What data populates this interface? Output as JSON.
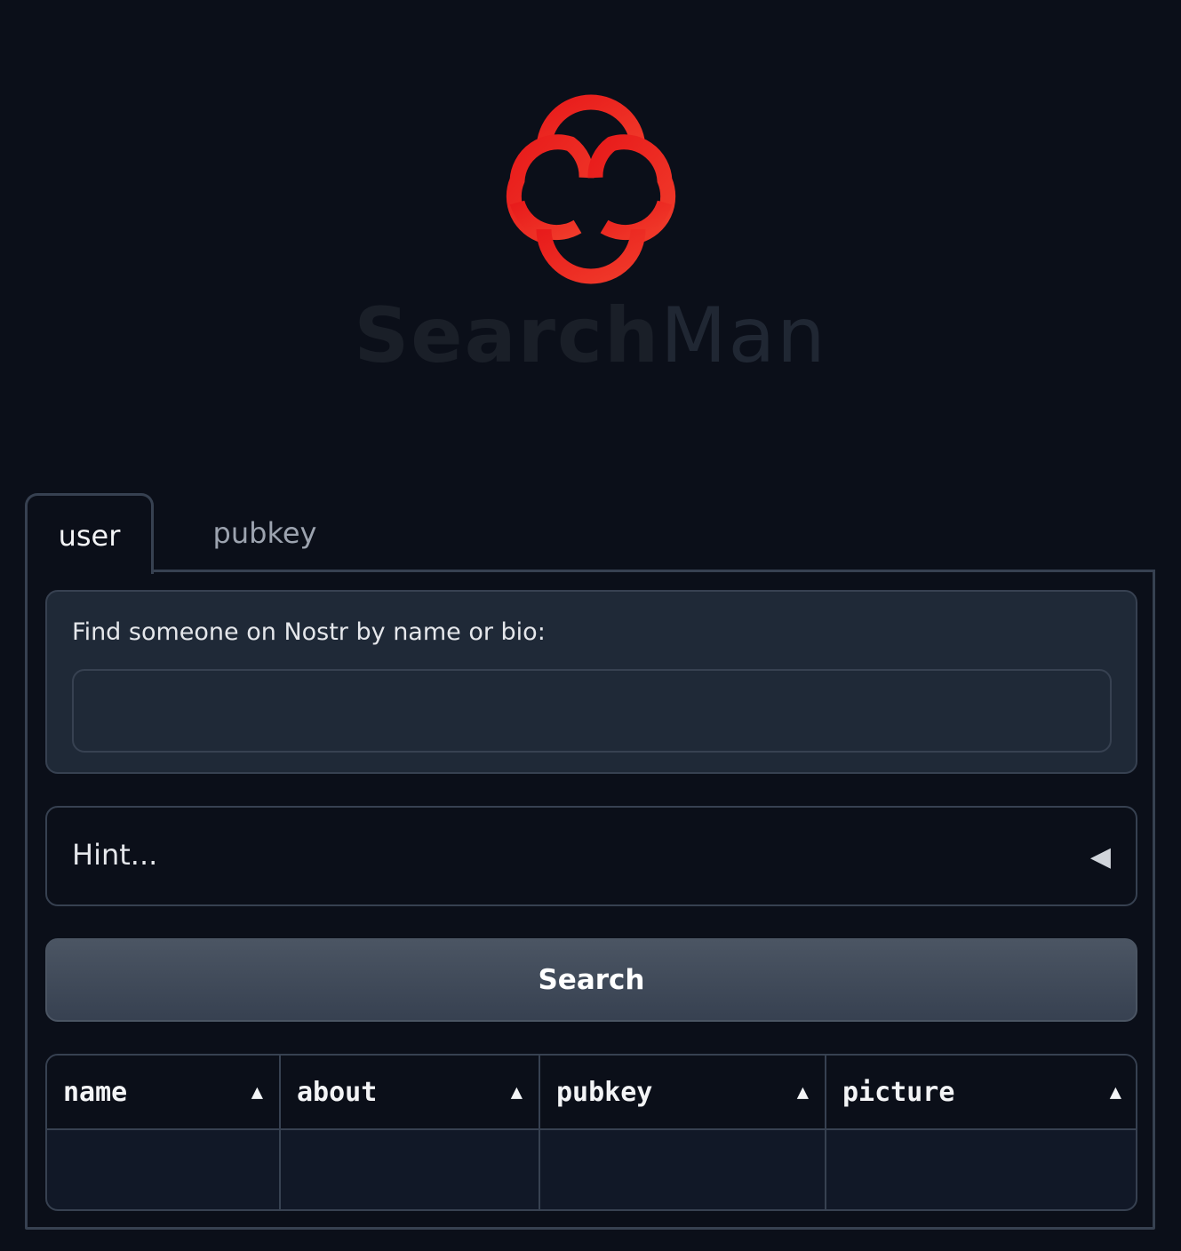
{
  "brand": {
    "name_part1": "Search",
    "name_part2": "Man",
    "logo_icon": "clover-logo-icon",
    "logo_color": "#e62222"
  },
  "tabs": [
    {
      "label": "user",
      "selected": true
    },
    {
      "label": "pubkey",
      "selected": false
    }
  ],
  "search_form": {
    "label": "Find someone on Nostr by name or bio:",
    "value": "",
    "placeholder": ""
  },
  "hint": {
    "label": "Hint...",
    "icon": "caret-left-icon",
    "expanded": false
  },
  "search_button": {
    "label": "Search"
  },
  "results_table": {
    "columns": [
      {
        "label": "name",
        "sort_icon": "sort-up-icon"
      },
      {
        "label": "about",
        "sort_icon": "sort-up-icon"
      },
      {
        "label": "pubkey",
        "sort_icon": "sort-up-icon"
      },
      {
        "label": "picture",
        "sort_icon": "sort-up-icon"
      }
    ],
    "rows": [
      [
        "",
        "",
        "",
        ""
      ]
    ]
  }
}
